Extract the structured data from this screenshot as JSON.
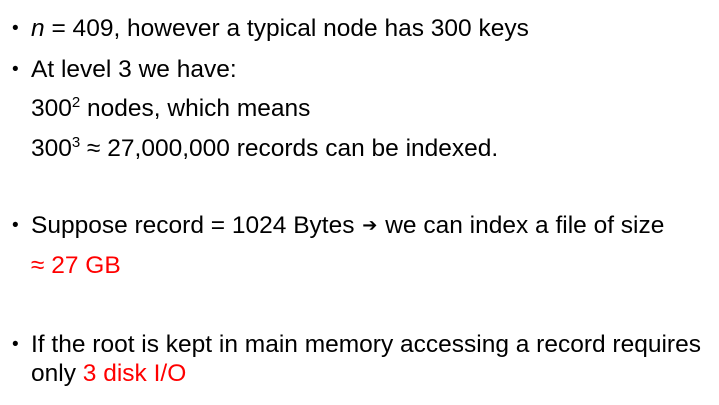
{
  "bullets": {
    "b1": {
      "glyph": "•",
      "var": "n",
      "rest": " = 409, however a typical node has 300 keys"
    },
    "b2": {
      "glyph": "•",
      "text": "At level 3 we have:",
      "sub1": {
        "base": "300",
        "exp": "2",
        "rest": " nodes, which means"
      },
      "sub2": {
        "base": "300",
        "exp": "3",
        "rest": " ≈ 27,000,000 records can be indexed."
      }
    },
    "b3": {
      "glyph": "•",
      "pre": "Suppose record = 1024 Bytes ",
      "arrow": "➔",
      "post": " we can index a file of size",
      "result": "≈ 27 GB"
    },
    "b4": {
      "glyph": "•",
      "line1": "If the root is kept in main memory accessing a record requires",
      "pre2": "only ",
      "highlight": "3 disk I/O"
    }
  },
  "colors": {
    "text": "#000000",
    "highlight": "#ff0000",
    "background": "#ffffff"
  }
}
